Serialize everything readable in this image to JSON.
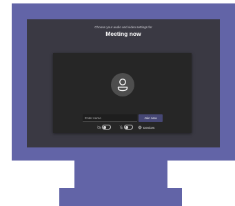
{
  "prejoin": {
    "subtitle": "Choose your audio and video settings for",
    "title": "Meeting now",
    "name_placeholder": "Enter name",
    "join_label": "Join now",
    "devices_label": "Devices"
  },
  "controls": {
    "camera_enabled": false,
    "microphone_enabled": false
  },
  "icons": {
    "avatar": "person-icon",
    "camera": "camera-off-icon",
    "microphone": "microphone-off-icon",
    "devices": "gear-icon"
  },
  "colors": {
    "monitor_frame": "#6264a7",
    "screen_background": "#3a3943",
    "panel_background": "#262626",
    "join_button": "#464775"
  }
}
